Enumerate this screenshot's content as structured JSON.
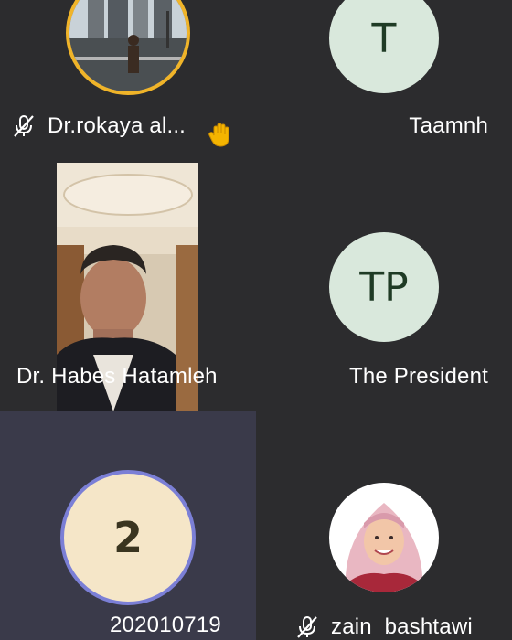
{
  "participants": [
    {
      "name": "Dr.rokaya al...",
      "muted": true,
      "hand_raised": true,
      "avatar": "street-photo"
    },
    {
      "name": "Taamnh",
      "initials": "T",
      "avatar_color": "#d9e8dc"
    },
    {
      "name": "Dr. Habes Hatamleh",
      "avatar": "video-feed-man"
    },
    {
      "name": "The President",
      "initials": "TP",
      "avatar_color": "#d9e8dc"
    },
    {
      "name": "202010719",
      "initials": "2",
      "avatar_color": "#f5e6c8",
      "active_speaker": true
    },
    {
      "name": "zain  bashtawi",
      "muted": true,
      "avatar": "woman-pink-hijab"
    }
  ],
  "colors": {
    "tile_bg": "#2c2c2e",
    "active_tile_bg": "#3a3a4a",
    "speaking_ring": "#f0b429",
    "active_ring": "#7b7fd6"
  }
}
